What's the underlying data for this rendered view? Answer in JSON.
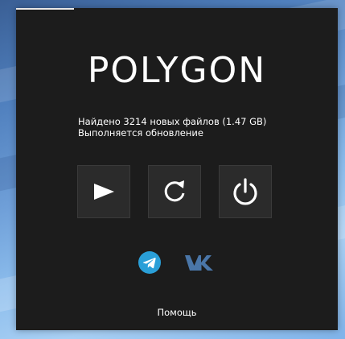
{
  "app": {
    "logo_text": "POLYGON",
    "progress": 0.18
  },
  "status": {
    "line1": "Найдено 3214 новых файлов (1.47 GB)",
    "line2": "Выполняется обновление"
  },
  "buttons": [
    {
      "name": "play-button",
      "icon": "play-icon"
    },
    {
      "name": "refresh-button",
      "icon": "refresh-icon"
    },
    {
      "name": "power-button",
      "icon": "power-icon"
    }
  ],
  "socials": [
    {
      "name": "telegram",
      "icon": "telegram-icon",
      "color": "#2a9fd8"
    },
    {
      "name": "vk",
      "icon": "vk-icon",
      "color": "#4a76a8"
    }
  ],
  "footer": {
    "help_label": "Помощь"
  },
  "colors": {
    "window_bg": "#1c1c1c",
    "button_bg": "#2b2b2b",
    "text": "#ffffff"
  }
}
